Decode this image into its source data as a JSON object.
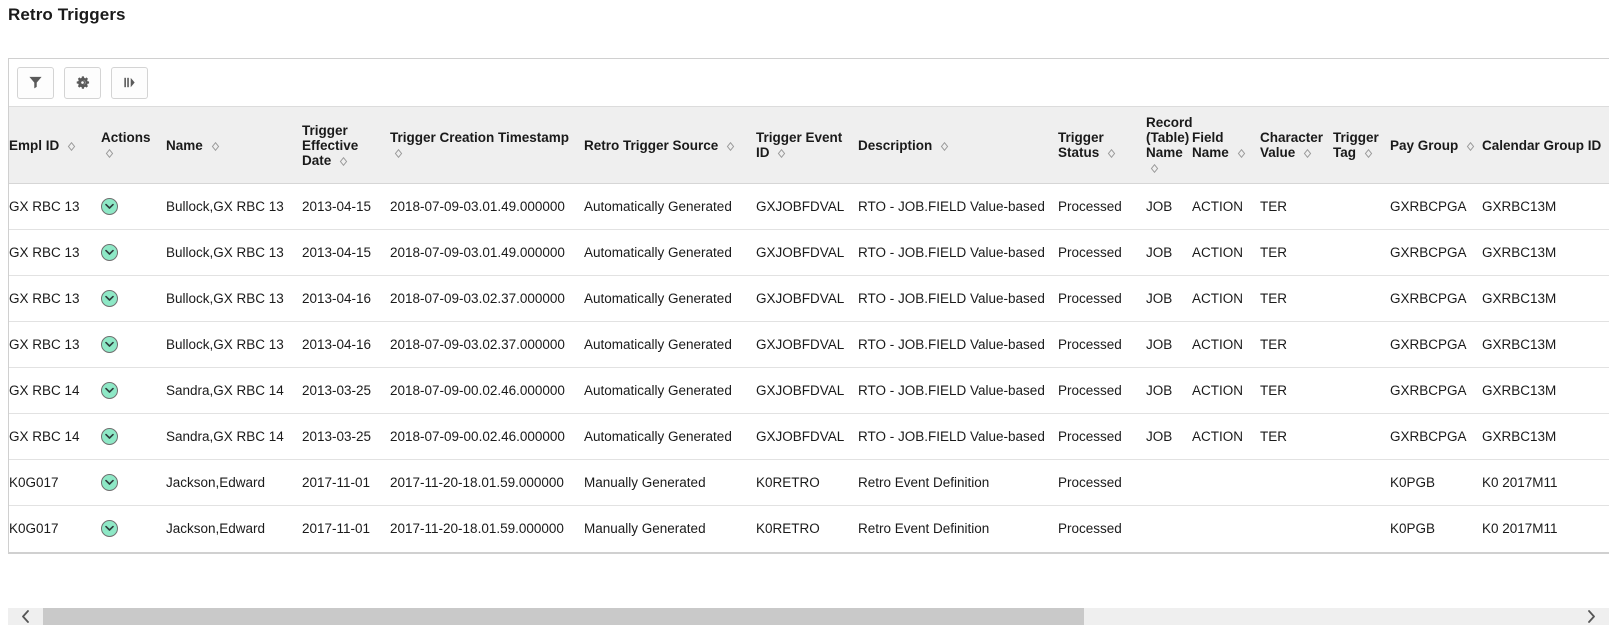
{
  "page": {
    "title": "Retro Triggers"
  },
  "toolbar": {
    "filter_label": "Filter",
    "personalize_label": "Personalize",
    "expand_label": "Show next columns",
    "icons": [
      "funnel-filter-icon",
      "gear-settings-icon",
      "next-columns-icon"
    ]
  },
  "grid": {
    "sort_icon": "sort-diamond-icon",
    "row_action_icon": "chevron-down-circle-icon",
    "columns": [
      {
        "key": "empl_id",
        "label": "Empl ID",
        "sortable": true
      },
      {
        "key": "actions",
        "label": "Actions",
        "sortable": true
      },
      {
        "key": "name",
        "label": "Name",
        "sortable": true
      },
      {
        "key": "trig_eff",
        "label": "Trigger Effective Date",
        "sortable": true
      },
      {
        "key": "trig_ts",
        "label": "Trigger Creation Timestamp",
        "sortable": true
      },
      {
        "key": "src",
        "label": "Retro Trigger Source",
        "sortable": true
      },
      {
        "key": "event_id",
        "label": "Trigger Event ID",
        "sortable": true
      },
      {
        "key": "desc",
        "label": "Description",
        "sortable": true
      },
      {
        "key": "status",
        "label": "Trigger Status",
        "sortable": true
      },
      {
        "key": "record",
        "label": "Record (Table) Name",
        "sortable": true
      },
      {
        "key": "field",
        "label": "Field Name",
        "sortable": true
      },
      {
        "key": "charval",
        "label": "Character Value",
        "sortable": true
      },
      {
        "key": "tag",
        "label": "Trigger Tag",
        "sortable": true
      },
      {
        "key": "paygroup",
        "label": "Pay Group",
        "sortable": true
      },
      {
        "key": "calgroup",
        "label": "Calendar Group ID",
        "sortable": true
      }
    ],
    "rows": [
      {
        "empl_id": "GX RBC 13",
        "actions": "",
        "name": "Bullock,GX RBC 13",
        "trig_eff": "2013-04-15",
        "trig_ts": "2018-07-09-03.01.49.000000",
        "src": "Automatically Generated",
        "event_id": "GXJOBFDVAL",
        "desc": "RTO - JOB.FIELD Value-based",
        "status": "Processed",
        "record": "JOB",
        "field": "ACTION",
        "charval": "TER",
        "tag": "",
        "paygroup": "GXRBCPGA",
        "calgroup": "GXRBC13M"
      },
      {
        "empl_id": "GX RBC 13",
        "actions": "",
        "name": "Bullock,GX RBC 13",
        "trig_eff": "2013-04-15",
        "trig_ts": "2018-07-09-03.01.49.000000",
        "src": "Automatically Generated",
        "event_id": "GXJOBFDVAL",
        "desc": "RTO - JOB.FIELD Value-based",
        "status": "Processed",
        "record": "JOB",
        "field": "ACTION",
        "charval": "TER",
        "tag": "",
        "paygroup": "GXRBCPGA",
        "calgroup": "GXRBC13M"
      },
      {
        "empl_id": "GX RBC 13",
        "actions": "",
        "name": "Bullock,GX RBC 13",
        "trig_eff": "2013-04-16",
        "trig_ts": "2018-07-09-03.02.37.000000",
        "src": "Automatically Generated",
        "event_id": "GXJOBFDVAL",
        "desc": "RTO - JOB.FIELD Value-based",
        "status": "Processed",
        "record": "JOB",
        "field": "ACTION",
        "charval": "TER",
        "tag": "",
        "paygroup": "GXRBCPGA",
        "calgroup": "GXRBC13M"
      },
      {
        "empl_id": "GX RBC 13",
        "actions": "",
        "name": "Bullock,GX RBC 13",
        "trig_eff": "2013-04-16",
        "trig_ts": "2018-07-09-03.02.37.000000",
        "src": "Automatically Generated",
        "event_id": "GXJOBFDVAL",
        "desc": "RTO - JOB.FIELD Value-based",
        "status": "Processed",
        "record": "JOB",
        "field": "ACTION",
        "charval": "TER",
        "tag": "",
        "paygroup": "GXRBCPGA",
        "calgroup": "GXRBC13M"
      },
      {
        "empl_id": "GX RBC 14",
        "actions": "",
        "name": "Sandra,GX RBC 14",
        "trig_eff": "2013-03-25",
        "trig_ts": "2018-07-09-00.02.46.000000",
        "src": "Automatically Generated",
        "event_id": "GXJOBFDVAL",
        "desc": "RTO - JOB.FIELD Value-based",
        "status": "Processed",
        "record": "JOB",
        "field": "ACTION",
        "charval": "TER",
        "tag": "",
        "paygroup": "GXRBCPGA",
        "calgroup": "GXRBC13M"
      },
      {
        "empl_id": "GX RBC 14",
        "actions": "",
        "name": "Sandra,GX RBC 14",
        "trig_eff": "2013-03-25",
        "trig_ts": "2018-07-09-00.02.46.000000",
        "src": "Automatically Generated",
        "event_id": "GXJOBFDVAL",
        "desc": "RTO - JOB.FIELD Value-based",
        "status": "Processed",
        "record": "JOB",
        "field": "ACTION",
        "charval": "TER",
        "tag": "",
        "paygroup": "GXRBCPGA",
        "calgroup": "GXRBC13M"
      },
      {
        "empl_id": "K0G017",
        "actions": "",
        "name": "Jackson,Edward",
        "trig_eff": "2017-11-01",
        "trig_ts": "2017-11-20-18.01.59.000000",
        "src": "Manually Generated",
        "event_id": "K0RETRO",
        "desc": "Retro Event Definition",
        "status": "Processed",
        "record": "",
        "field": "",
        "charval": "",
        "tag": "",
        "paygroup": "K0PGB",
        "calgroup": "K0 2017M11"
      },
      {
        "empl_id": "K0G017",
        "actions": "",
        "name": "Jackson,Edward",
        "trig_eff": "2017-11-01",
        "trig_ts": "2017-11-20-18.01.59.000000",
        "src": "Manually Generated",
        "event_id": "K0RETRO",
        "desc": "Retro Event Definition",
        "status": "Processed",
        "record": "",
        "field": "",
        "charval": "",
        "tag": "",
        "paygroup": "K0PGB",
        "calgroup": "K0 2017M11"
      }
    ]
  },
  "scrollbar": {
    "left_arrow": "chevron-left-icon",
    "right_arrow": "chevron-right-icon",
    "thumb_percent": 68
  },
  "colors": {
    "header_bg": "#efefef",
    "row_border": "#e2e2e2",
    "action_icon_bg": "#8ee8c6",
    "text": "#1a1a1a",
    "scroll_thumb": "#c9c9c9"
  }
}
